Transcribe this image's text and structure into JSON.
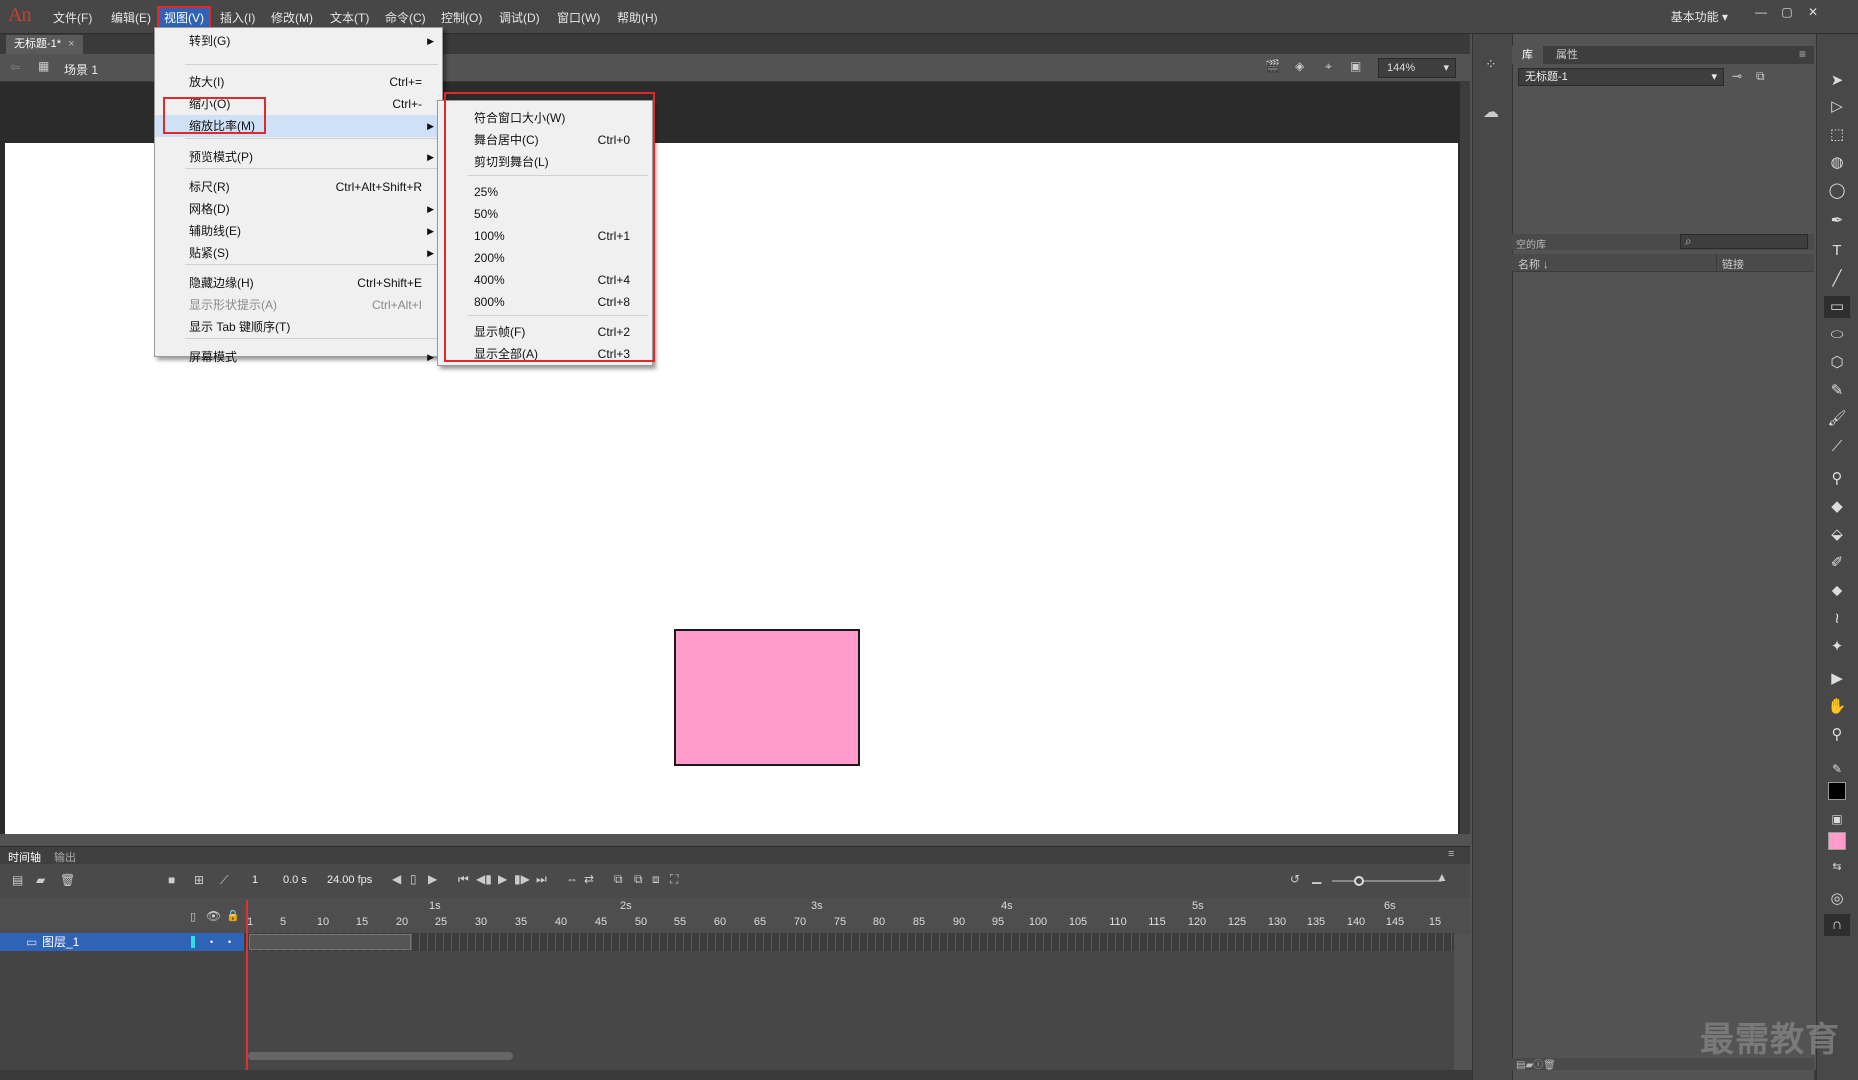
{
  "app": {
    "logo": "An"
  },
  "menubar": {
    "items": [
      "文件(F)",
      "编辑(E)",
      "视图(V)",
      "插入(I)",
      "修改(M)",
      "文本(T)",
      "命令(C)",
      "控制(O)",
      "调试(D)",
      "窗口(W)",
      "帮助(H)"
    ],
    "active": "视图(V)"
  },
  "workspace": {
    "label": "基本功能"
  },
  "document": {
    "tab": "无标题-1*",
    "scene": "场景 1",
    "zoom": "144%"
  },
  "view_menu": {
    "items": [
      {
        "label": "转到(G)",
        "shortcut": "",
        "submenu": true,
        "disabled": false
      },
      {
        "label": "放大(I)",
        "shortcut": "Ctrl+=",
        "submenu": false,
        "disabled": false
      },
      {
        "label": "缩小(O)",
        "shortcut": "Ctrl+-",
        "submenu": false,
        "disabled": false
      },
      {
        "label": "缩放比率(M)",
        "shortcut": "",
        "submenu": true,
        "disabled": false,
        "highlight": true
      },
      {
        "label": "预览模式(P)",
        "shortcut": "",
        "submenu": true,
        "disabled": false
      },
      {
        "label": "标尺(R)",
        "shortcut": "Ctrl+Alt+Shift+R",
        "submenu": false,
        "disabled": false
      },
      {
        "label": "网格(D)",
        "shortcut": "",
        "submenu": true,
        "disabled": false
      },
      {
        "label": "辅助线(E)",
        "shortcut": "",
        "submenu": true,
        "disabled": false
      },
      {
        "label": "贴紧(S)",
        "shortcut": "",
        "submenu": true,
        "disabled": false
      },
      {
        "label": "隐藏边缘(H)",
        "shortcut": "Ctrl+Shift+E",
        "submenu": false,
        "disabled": false
      },
      {
        "label": "显示形状提示(A)",
        "shortcut": "Ctrl+Alt+I",
        "submenu": false,
        "disabled": true
      },
      {
        "label": "显示 Tab 键顺序(T)",
        "shortcut": "",
        "submenu": false,
        "disabled": false
      },
      {
        "label": "屏幕模式",
        "shortcut": "",
        "submenu": true,
        "disabled": false
      }
    ]
  },
  "zoom_menu": {
    "items": [
      {
        "label": "符合窗口大小(W)",
        "shortcut": ""
      },
      {
        "label": "舞台居中(C)",
        "shortcut": "Ctrl+0"
      },
      {
        "label": "剪切到舞台(L)",
        "shortcut": ""
      },
      {
        "label": "25%",
        "shortcut": ""
      },
      {
        "label": "50%",
        "shortcut": ""
      },
      {
        "label": "100%",
        "shortcut": "Ctrl+1"
      },
      {
        "label": "200%",
        "shortcut": ""
      },
      {
        "label": "400%",
        "shortcut": "Ctrl+4"
      },
      {
        "label": "800%",
        "shortcut": "Ctrl+8"
      },
      {
        "label": "显示帧(F)",
        "shortcut": "Ctrl+2"
      },
      {
        "label": "显示全部(A)",
        "shortcut": "Ctrl+3"
      }
    ]
  },
  "stage": {
    "background": "#ffffff",
    "shape_color": "#ff9ccc"
  },
  "timeline": {
    "tabs": [
      "时间轴",
      "输出"
    ],
    "current_frame": "1",
    "time": "0.0 s",
    "fps": "24.00 fps",
    "layer": "图层_1",
    "frame_ticks": [
      "1",
      "5",
      "10",
      "15",
      "20",
      "25",
      "30",
      "35",
      "40",
      "45",
      "50",
      "55",
      "60",
      "65",
      "70",
      "75",
      "80",
      "85",
      "90",
      "95",
      "100",
      "105",
      "110",
      "115",
      "120",
      "125",
      "130",
      "135",
      "140",
      "145",
      "15"
    ],
    "seconds": [
      "1s",
      "2s",
      "3s",
      "4s",
      "5s",
      "6s"
    ]
  },
  "panels": {
    "tabs": [
      "库",
      "属性"
    ],
    "library_doc": "无标题-1",
    "library_empty": "空的库",
    "col_name": "名称",
    "col_link": "链接"
  },
  "watermark": "最需教育"
}
